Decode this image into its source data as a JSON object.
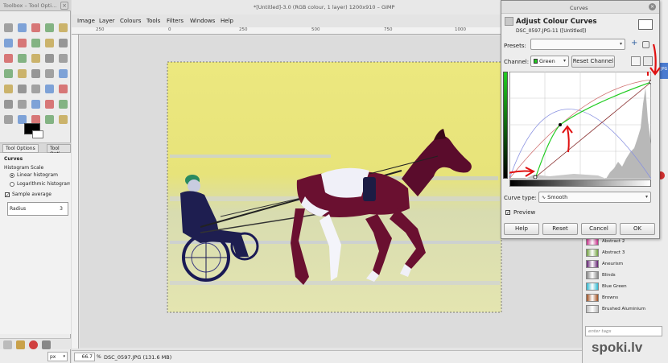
{
  "toolbox": {
    "title": "Toolbox – Tool Opti…",
    "tabs": [
      "Tool Options",
      "Tool Opti…"
    ],
    "section": "Curves",
    "histogram_label": "Histogram Scale",
    "linear": "Linear histogram",
    "logarithmic": "Logarithmic histogram",
    "sample_average": "Sample average",
    "radius_label": "Radius",
    "radius_value": "3"
  },
  "main": {
    "title": "*[Untitled]-3.0 (RGB colour, 1 layer) 1200x910 – GIMP",
    "menu": [
      "Image",
      "Layer",
      "Colours",
      "Tools",
      "Filters",
      "Windows",
      "Help"
    ],
    "ruler_labels": [
      "250",
      "0",
      "250",
      "500",
      "750",
      "1000"
    ],
    "status": {
      "unit": "px",
      "zoom": "66.7",
      "zoom_unit": "%",
      "info": "DSC_0597.JPG (131.6 MB)"
    }
  },
  "curves": {
    "window_title": "Curves",
    "heading": "Adjust Colour Curves",
    "subtitle": "DSC_0597.JPG-11 ([Untitled])",
    "presets_label": "Presets:",
    "channel_label": "Channel:",
    "channel_value": "Green",
    "reset_channel": "Reset Channel",
    "curve_type_label": "Curve type:",
    "curve_type_value": "Smooth",
    "preview": "Preview",
    "buttons": {
      "help": "Help",
      "reset": "Reset",
      "cancel": "Cancel",
      "ok": "OK"
    }
  },
  "dock": {
    "brushes": [
      {
        "name": "Abstract 2",
        "color": "#c8308c"
      },
      {
        "name": "Abstract 3",
        "color": "#70a040"
      },
      {
        "name": "Aneurism",
        "color": "#602070"
      },
      {
        "name": "Blinds",
        "color": "#888888"
      },
      {
        "name": "Blue Green",
        "color": "#30b8d0"
      },
      {
        "name": "Browns",
        "color": "#a05020"
      },
      {
        "name": "Brushed Aluminium",
        "color": "#bbbbbb"
      }
    ],
    "tag_placeholder": "enter tags",
    "side_label": "JPG"
  },
  "watermark": "spoki.lv",
  "colors": {
    "image_bg": "#e6e27a",
    "curve_green": "#22cc22",
    "arrow_red": "#e01010"
  }
}
